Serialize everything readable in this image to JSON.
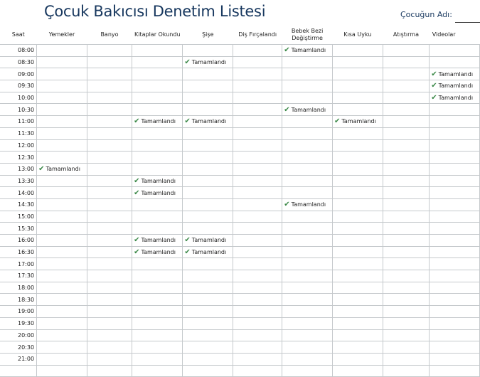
{
  "title": "Çocuk Bakıcısı Denetim Listesi",
  "child_label": "Çocuğun Adı:",
  "columns": [
    "Saat",
    "Yemekler",
    "Banyo",
    "Kitaplar Okundu",
    "Şişe",
    "Diş Fırçalandı",
    "Bebek Bezi Değiştirme",
    "Kısa Uyku",
    "Atıştırma",
    "Videolar"
  ],
  "done_text": "Tamamlandı",
  "check_icon": "checkmark-icon",
  "rows": [
    {
      "time": "08:00",
      "done": [
        6
      ]
    },
    {
      "time": "08:30",
      "done": [
        4
      ]
    },
    {
      "time": "09:00",
      "done": [
        9
      ]
    },
    {
      "time": "09:30",
      "done": [
        9
      ]
    },
    {
      "time": "10:00",
      "done": [
        9
      ]
    },
    {
      "time": "10:30",
      "done": [
        6
      ]
    },
    {
      "time": "11:00",
      "done": [
        3,
        4,
        7
      ]
    },
    {
      "time": "11:30",
      "done": []
    },
    {
      "time": "12:00",
      "done": []
    },
    {
      "time": "12:30",
      "done": []
    },
    {
      "time": "13:00",
      "done": [
        1
      ]
    },
    {
      "time": "13:30",
      "done": [
        3
      ]
    },
    {
      "time": "14:00",
      "done": [
        3
      ]
    },
    {
      "time": "14:30",
      "done": [
        6
      ]
    },
    {
      "time": "15:00",
      "done": []
    },
    {
      "time": "15:30",
      "done": []
    },
    {
      "time": "16:00",
      "done": [
        3,
        4
      ]
    },
    {
      "time": "16:30",
      "done": [
        3,
        4
      ]
    },
    {
      "time": "17:00",
      "done": []
    },
    {
      "time": "17:30",
      "done": []
    },
    {
      "time": "18:00",
      "done": []
    },
    {
      "time": "18:30",
      "done": []
    },
    {
      "time": "19:00",
      "done": []
    },
    {
      "time": "19:30",
      "done": []
    },
    {
      "time": "20:00",
      "done": []
    },
    {
      "time": "20:30",
      "done": []
    },
    {
      "time": "21:00",
      "done": []
    },
    {
      "time": "",
      "done": []
    }
  ],
  "colors": {
    "title": "#17375e",
    "check": "#3d8a4a",
    "grid": "#c5c9cc"
  }
}
